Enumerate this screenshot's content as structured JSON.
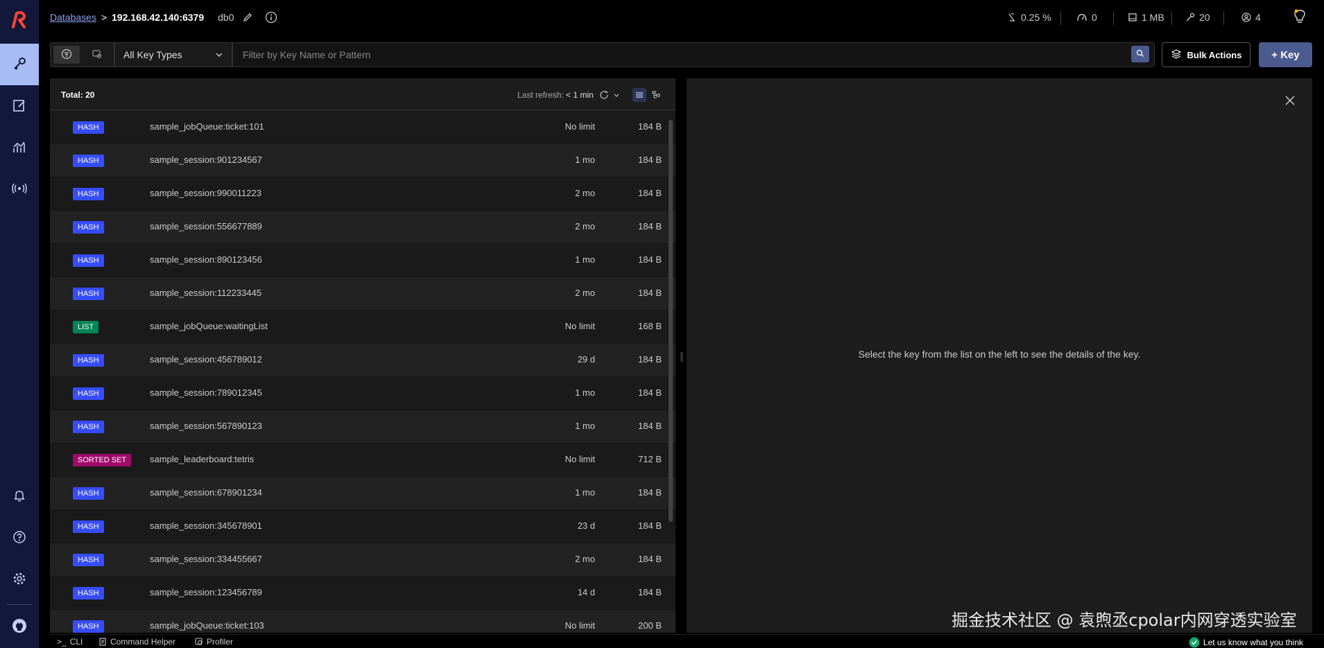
{
  "header": {
    "breadcrumb_link": "Databases",
    "breadcrumb_sep": ">",
    "host": "192.168.42.140:6379",
    "db": "db0",
    "stats": {
      "cpu": "0.25 %",
      "ops": "0",
      "memory": "1 MB",
      "keys": "20",
      "clients": "4"
    }
  },
  "toolbar": {
    "key_type": "All Key Types",
    "filter_placeholder": "Filter by Key Name or Pattern",
    "bulk_label": "Bulk Actions",
    "add_label": "+ Key"
  },
  "list": {
    "total": "Total: 20",
    "refresh_label": "Last refresh:",
    "refresh_value": "< 1 min",
    "rows": [
      {
        "type": "HASH",
        "name": "sample_jobQueue:ticket:101",
        "ttl": "No limit",
        "size": "184 B"
      },
      {
        "type": "HASH",
        "name": "sample_session:901234567",
        "ttl": "1 mo",
        "size": "184 B"
      },
      {
        "type": "HASH",
        "name": "sample_session:990011223",
        "ttl": "2 mo",
        "size": "184 B"
      },
      {
        "type": "HASH",
        "name": "sample_session:556677889",
        "ttl": "2 mo",
        "size": "184 B"
      },
      {
        "type": "HASH",
        "name": "sample_session:890123456",
        "ttl": "1 mo",
        "size": "184 B"
      },
      {
        "type": "HASH",
        "name": "sample_session:112233445",
        "ttl": "2 mo",
        "size": "184 B"
      },
      {
        "type": "LIST",
        "name": "sample_jobQueue:waitingList",
        "ttl": "No limit",
        "size": "168 B"
      },
      {
        "type": "HASH",
        "name": "sample_session:456789012",
        "ttl": "29 d",
        "size": "184 B"
      },
      {
        "type": "HASH",
        "name": "sample_session:789012345",
        "ttl": "1 mo",
        "size": "184 B"
      },
      {
        "type": "HASH",
        "name": "sample_session:567890123",
        "ttl": "1 mo",
        "size": "184 B"
      },
      {
        "type": "SORTED SET",
        "name": "sample_leaderboard:tetris",
        "ttl": "No limit",
        "size": "712 B"
      },
      {
        "type": "HASH",
        "name": "sample_session:678901234",
        "ttl": "1 mo",
        "size": "184 B"
      },
      {
        "type": "HASH",
        "name": "sample_session:345678901",
        "ttl": "23 d",
        "size": "184 B"
      },
      {
        "type": "HASH",
        "name": "sample_session:334455667",
        "ttl": "2 mo",
        "size": "184 B"
      },
      {
        "type": "HASH",
        "name": "sample_session:123456789",
        "ttl": "14 d",
        "size": "184 B"
      },
      {
        "type": "HASH",
        "name": "sample_jobQueue:ticket:103",
        "ttl": "No limit",
        "size": "200 B"
      }
    ]
  },
  "details": {
    "empty_message": "Select the key from the list on the left to see the details of the key."
  },
  "watermark": "掘金技术社区 @ 袁煦丞cpolar内网穿透实验室",
  "footer": {
    "cli": "CLI",
    "cli_prompt": ">_",
    "command_helper": "Command Helper",
    "profiler": "Profiler",
    "feedback": "Let us know what you think"
  },
  "colors": {
    "HASH": "#364cff",
    "LIST": "#008556",
    "SORTED SET": "#a00a6b",
    "sidebar_bg": "#11183a",
    "accent": "#4b5a8f"
  }
}
